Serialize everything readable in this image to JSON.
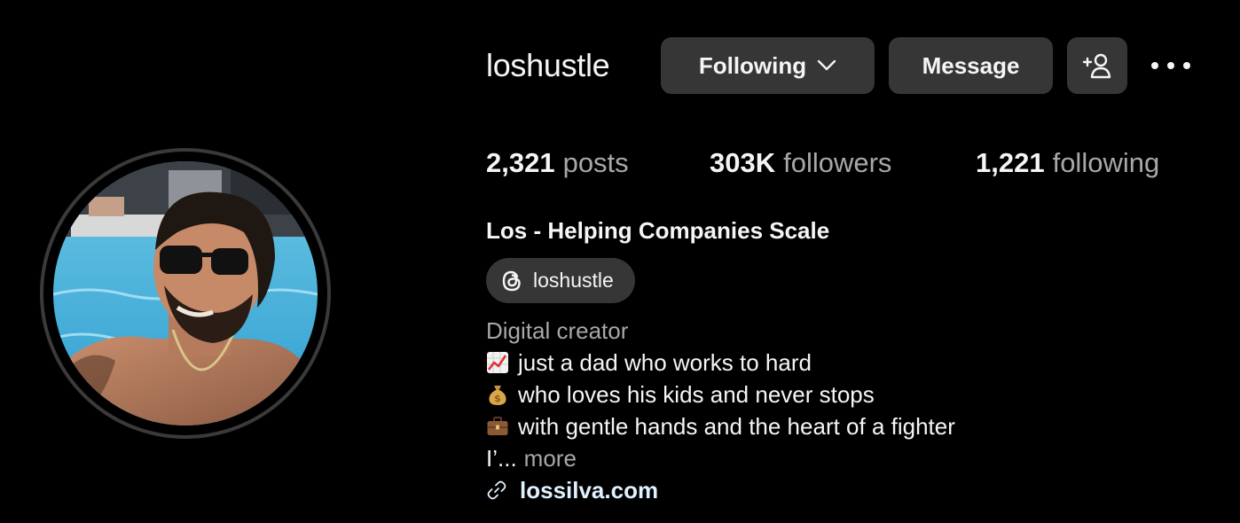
{
  "profile": {
    "username": "loshustle",
    "full_name": "Los - Helping Companies Scale",
    "avatar_icon": "profile-photo"
  },
  "actions": {
    "following_label": "Following",
    "message_label": "Message",
    "add_user_icon": "add-user-icon",
    "more_icon": "more-options-icon"
  },
  "stats": [
    {
      "value": "2,321",
      "label": "posts"
    },
    {
      "value": "303K",
      "label": "followers"
    },
    {
      "value": "1,221",
      "label": "following"
    }
  ],
  "threads": {
    "handle": "loshustle",
    "icon": "threads-icon"
  },
  "bio": {
    "category": "Digital creator",
    "lines": [
      {
        "icon": "chart-increasing-emoji",
        "text": "just a dad who works to hard"
      },
      {
        "icon": "money-bag-emoji",
        "text": "who loves his kids and never stops"
      },
      {
        "icon": "briefcase-emoji",
        "text": "with gentle hands and the heart of a fighter"
      }
    ],
    "truncated_text": "I’...",
    "more_label": "more"
  },
  "link": {
    "icon": "link-icon",
    "text": "lossilva.com"
  },
  "colors": {
    "background": "#000000",
    "button_bg": "#363636",
    "primary_text": "#f5f5f5",
    "secondary_text": "#a8a8a8",
    "link_text": "#e0f1ff"
  }
}
